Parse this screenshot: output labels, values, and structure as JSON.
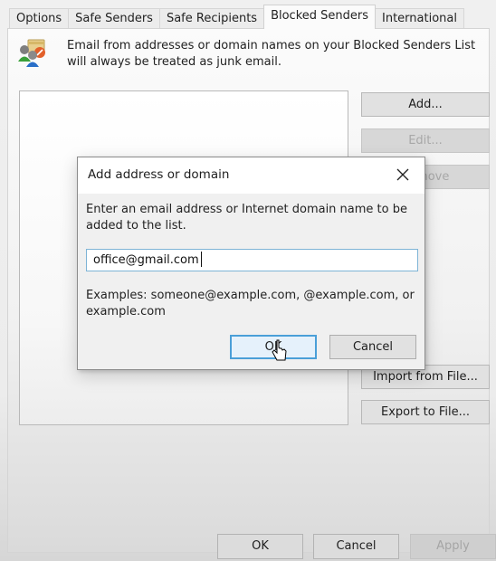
{
  "tabs": [
    {
      "label": "Options",
      "active": false
    },
    {
      "label": "Safe Senders",
      "active": false
    },
    {
      "label": "Safe Recipients",
      "active": false
    },
    {
      "label": "Blocked Senders",
      "active": true
    },
    {
      "label": "International",
      "active": false
    }
  ],
  "panel": {
    "intro_icon": "blocked-senders-people-icon",
    "intro_text": "Email from addresses or domain names on your Blocked Senders List will always be treated as junk email.",
    "list_items": [],
    "buttons": {
      "add": {
        "label": "Add...",
        "enabled": true
      },
      "edit": {
        "label": "Edit...",
        "enabled": false
      },
      "remove": {
        "label": "Remove",
        "enabled": false
      },
      "import": {
        "label": "Import from File...",
        "enabled": true
      },
      "export": {
        "label": "Export to File...",
        "enabled": true
      }
    }
  },
  "footer": {
    "ok": "OK",
    "cancel": "Cancel",
    "apply": "Apply"
  },
  "dialog": {
    "title": "Add address or domain",
    "close_icon": "close-icon",
    "description": "Enter an email address or Internet domain name to be added to the list.",
    "input_value": "office@gmail.com",
    "examples": "Examples: someone@example.com, @example.com, or example.com",
    "ok": "OK",
    "cancel": "Cancel",
    "accent_color": "#4a9fd8"
  }
}
